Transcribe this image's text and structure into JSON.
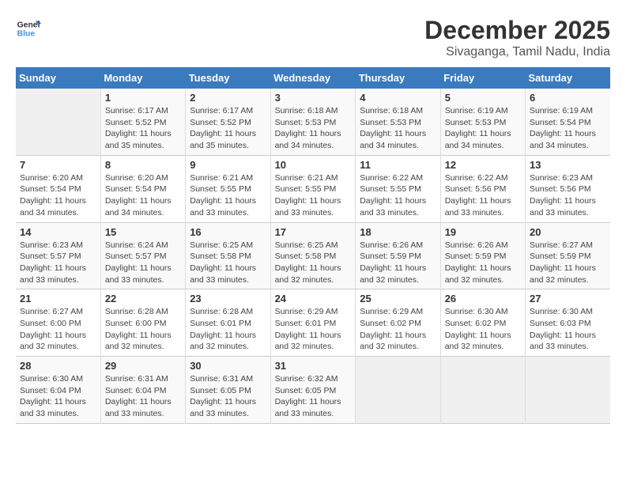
{
  "logo": {
    "line1": "General",
    "line2": "Blue"
  },
  "title": "December 2025",
  "subtitle": "Sivaganga, Tamil Nadu, India",
  "header": {
    "days": [
      "Sunday",
      "Monday",
      "Tuesday",
      "Wednesday",
      "Thursday",
      "Friday",
      "Saturday"
    ]
  },
  "weeks": [
    [
      {
        "num": "",
        "sunrise": "",
        "sunset": "",
        "daylight": ""
      },
      {
        "num": "1",
        "sunrise": "Sunrise: 6:17 AM",
        "sunset": "Sunset: 5:52 PM",
        "daylight": "Daylight: 11 hours and 35 minutes."
      },
      {
        "num": "2",
        "sunrise": "Sunrise: 6:17 AM",
        "sunset": "Sunset: 5:52 PM",
        "daylight": "Daylight: 11 hours and 35 minutes."
      },
      {
        "num": "3",
        "sunrise": "Sunrise: 6:18 AM",
        "sunset": "Sunset: 5:53 PM",
        "daylight": "Daylight: 11 hours and 34 minutes."
      },
      {
        "num": "4",
        "sunrise": "Sunrise: 6:18 AM",
        "sunset": "Sunset: 5:53 PM",
        "daylight": "Daylight: 11 hours and 34 minutes."
      },
      {
        "num": "5",
        "sunrise": "Sunrise: 6:19 AM",
        "sunset": "Sunset: 5:53 PM",
        "daylight": "Daylight: 11 hours and 34 minutes."
      },
      {
        "num": "6",
        "sunrise": "Sunrise: 6:19 AM",
        "sunset": "Sunset: 5:54 PM",
        "daylight": "Daylight: 11 hours and 34 minutes."
      }
    ],
    [
      {
        "num": "7",
        "sunrise": "Sunrise: 6:20 AM",
        "sunset": "Sunset: 5:54 PM",
        "daylight": "Daylight: 11 hours and 34 minutes."
      },
      {
        "num": "8",
        "sunrise": "Sunrise: 6:20 AM",
        "sunset": "Sunset: 5:54 PM",
        "daylight": "Daylight: 11 hours and 34 minutes."
      },
      {
        "num": "9",
        "sunrise": "Sunrise: 6:21 AM",
        "sunset": "Sunset: 5:55 PM",
        "daylight": "Daylight: 11 hours and 33 minutes."
      },
      {
        "num": "10",
        "sunrise": "Sunrise: 6:21 AM",
        "sunset": "Sunset: 5:55 PM",
        "daylight": "Daylight: 11 hours and 33 minutes."
      },
      {
        "num": "11",
        "sunrise": "Sunrise: 6:22 AM",
        "sunset": "Sunset: 5:55 PM",
        "daylight": "Daylight: 11 hours and 33 minutes."
      },
      {
        "num": "12",
        "sunrise": "Sunrise: 6:22 AM",
        "sunset": "Sunset: 5:56 PM",
        "daylight": "Daylight: 11 hours and 33 minutes."
      },
      {
        "num": "13",
        "sunrise": "Sunrise: 6:23 AM",
        "sunset": "Sunset: 5:56 PM",
        "daylight": "Daylight: 11 hours and 33 minutes."
      }
    ],
    [
      {
        "num": "14",
        "sunrise": "Sunrise: 6:23 AM",
        "sunset": "Sunset: 5:57 PM",
        "daylight": "Daylight: 11 hours and 33 minutes."
      },
      {
        "num": "15",
        "sunrise": "Sunrise: 6:24 AM",
        "sunset": "Sunset: 5:57 PM",
        "daylight": "Daylight: 11 hours and 33 minutes."
      },
      {
        "num": "16",
        "sunrise": "Sunrise: 6:25 AM",
        "sunset": "Sunset: 5:58 PM",
        "daylight": "Daylight: 11 hours and 33 minutes."
      },
      {
        "num": "17",
        "sunrise": "Sunrise: 6:25 AM",
        "sunset": "Sunset: 5:58 PM",
        "daylight": "Daylight: 11 hours and 32 minutes."
      },
      {
        "num": "18",
        "sunrise": "Sunrise: 6:26 AM",
        "sunset": "Sunset: 5:59 PM",
        "daylight": "Daylight: 11 hours and 32 minutes."
      },
      {
        "num": "19",
        "sunrise": "Sunrise: 6:26 AM",
        "sunset": "Sunset: 5:59 PM",
        "daylight": "Daylight: 11 hours and 32 minutes."
      },
      {
        "num": "20",
        "sunrise": "Sunrise: 6:27 AM",
        "sunset": "Sunset: 5:59 PM",
        "daylight": "Daylight: 11 hours and 32 minutes."
      }
    ],
    [
      {
        "num": "21",
        "sunrise": "Sunrise: 6:27 AM",
        "sunset": "Sunset: 6:00 PM",
        "daylight": "Daylight: 11 hours and 32 minutes."
      },
      {
        "num": "22",
        "sunrise": "Sunrise: 6:28 AM",
        "sunset": "Sunset: 6:00 PM",
        "daylight": "Daylight: 11 hours and 32 minutes."
      },
      {
        "num": "23",
        "sunrise": "Sunrise: 6:28 AM",
        "sunset": "Sunset: 6:01 PM",
        "daylight": "Daylight: 11 hours and 32 minutes."
      },
      {
        "num": "24",
        "sunrise": "Sunrise: 6:29 AM",
        "sunset": "Sunset: 6:01 PM",
        "daylight": "Daylight: 11 hours and 32 minutes."
      },
      {
        "num": "25",
        "sunrise": "Sunrise: 6:29 AM",
        "sunset": "Sunset: 6:02 PM",
        "daylight": "Daylight: 11 hours and 32 minutes."
      },
      {
        "num": "26",
        "sunrise": "Sunrise: 6:30 AM",
        "sunset": "Sunset: 6:02 PM",
        "daylight": "Daylight: 11 hours and 32 minutes."
      },
      {
        "num": "27",
        "sunrise": "Sunrise: 6:30 AM",
        "sunset": "Sunset: 6:03 PM",
        "daylight": "Daylight: 11 hours and 33 minutes."
      }
    ],
    [
      {
        "num": "28",
        "sunrise": "Sunrise: 6:30 AM",
        "sunset": "Sunset: 6:04 PM",
        "daylight": "Daylight: 11 hours and 33 minutes."
      },
      {
        "num": "29",
        "sunrise": "Sunrise: 6:31 AM",
        "sunset": "Sunset: 6:04 PM",
        "daylight": "Daylight: 11 hours and 33 minutes."
      },
      {
        "num": "30",
        "sunrise": "Sunrise: 6:31 AM",
        "sunset": "Sunset: 6:05 PM",
        "daylight": "Daylight: 11 hours and 33 minutes."
      },
      {
        "num": "31",
        "sunrise": "Sunrise: 6:32 AM",
        "sunset": "Sunset: 6:05 PM",
        "daylight": "Daylight: 11 hours and 33 minutes."
      },
      {
        "num": "",
        "sunrise": "",
        "sunset": "",
        "daylight": ""
      },
      {
        "num": "",
        "sunrise": "",
        "sunset": "",
        "daylight": ""
      },
      {
        "num": "",
        "sunrise": "",
        "sunset": "",
        "daylight": ""
      }
    ]
  ]
}
